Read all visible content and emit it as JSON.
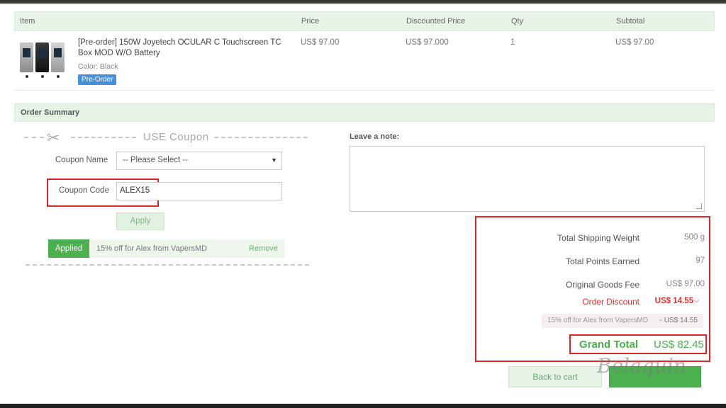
{
  "cart": {
    "columns": [
      "Item",
      "Price",
      "Discounted Price",
      "Qty",
      "Subtotal"
    ],
    "product": {
      "title": "[Pre-order] 150W Joyetech OCULAR C Touchscreen TC Box MOD W/O Battery",
      "color": "Color: Black",
      "badge": "Pre-Order",
      "price": "US$ 97.00",
      "discounted_price": "US$ 97.000",
      "qty": "1",
      "subtotal": "US$ 97.00"
    }
  },
  "summary": {
    "title": "Order Summary",
    "coupon": {
      "heading": "USE Coupon",
      "name_label": "Coupon Name",
      "name_selected": "-- Please Select --",
      "code_label": "Coupon Code",
      "code_value": "ALEX15",
      "apply_label": "Apply",
      "applied_tag": "Applied",
      "applied_text": "15% off for Alex from VapersMD",
      "remove_label": "Remove"
    },
    "note": {
      "label": "Leave a note:",
      "value": ""
    },
    "totals": {
      "shipping_weight_label": "Total Shipping Weight",
      "shipping_weight_value": "500 g",
      "points_label": "Total Points Earned",
      "points_value": "97",
      "original_fee_label": "Original Goods Fee",
      "original_fee_value": "US$ 97.00",
      "discount_label": "Order Discount",
      "discount_value": "US$ 14.55",
      "discount_detail_text": "15% off for Alex from VapersMD",
      "discount_detail_amount": "- US$ 14.55",
      "grand_total_label": "Grand Total",
      "grand_total_value": "US$ 82.45"
    },
    "buttons": {
      "back_to_cart": "Back to cart"
    }
  },
  "colors": {
    "header_bg": "#e6f3e6",
    "accent_green": "#4caf50",
    "highlight_red": "#d9262c",
    "discount_red": "#dd3333",
    "badge_blue": "#4a90d9"
  },
  "watermark": "Belaquin"
}
